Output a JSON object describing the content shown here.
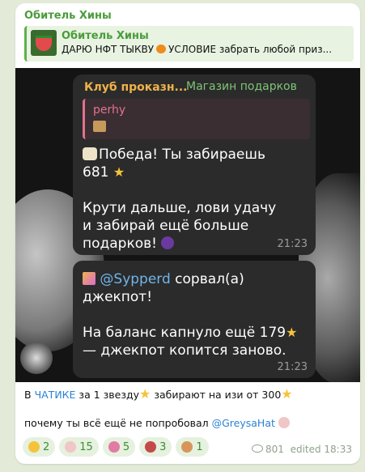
{
  "post": {
    "channel_title": "Обитель Хины",
    "quote": {
      "title": "Обитель Хины",
      "text_before": "ДАРЮ НФТ ТЫКВУ",
      "text_after": "УСЛОВИЕ забрать любой приз..."
    },
    "card1": {
      "sender": "Клуб проказн...",
      "tag": "Магазин подарков",
      "reply_name": "perhy",
      "line1": "Победа! Ты забираешь",
      "line2": "681",
      "line3": "Крути дальше, лови удачу",
      "line4": "и забирай ещё больше",
      "line5": "подарков!",
      "time": "21:23"
    },
    "card2": {
      "mention": "@Sypperd",
      "line1_rest": " сорвал(а)",
      "line2": "джекпот!",
      "line3": "На баланс капнуло ещё 179",
      "line4": "— джекпот копится заново.",
      "time": "21:23"
    },
    "caption": {
      "part1": "В ",
      "link": "ЧАТИКЕ",
      "part2": " за 1 звезду",
      "part3": " забирают на изи от 300",
      "line2": "почему ты всё ещё не попробовал ",
      "mention": "@GreysaHat"
    },
    "reactions": [
      {
        "icon": "star-icon",
        "count": "2",
        "color": "#f5c33b"
      },
      {
        "icon": "hand-icon",
        "count": "15",
        "color": "#f0c6c6"
      },
      {
        "icon": "face-icon",
        "count": "5",
        "color": "#e27aa3"
      },
      {
        "icon": "character-icon",
        "count": "3",
        "color": "#c44a4a"
      },
      {
        "icon": "figure-icon",
        "count": "1",
        "color": "#d8955a"
      }
    ],
    "views": "801",
    "edited": "edited 18:33"
  },
  "colors": {
    "accent_green": "#4a9c3c",
    "link_blue": "#2a82d4",
    "dark_card": "#2b2b2b"
  }
}
